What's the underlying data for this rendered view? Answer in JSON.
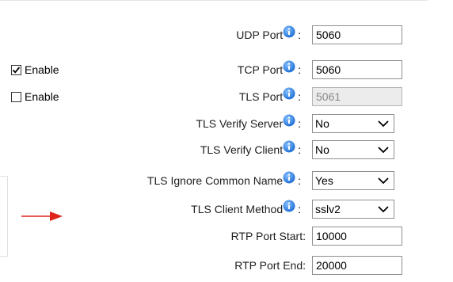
{
  "form": {
    "udp_port": {
      "label": "UDP Port",
      "value": "5060"
    },
    "tcp_port": {
      "label": "TCP Port",
      "value": "5060",
      "enable_label": "Enable",
      "enabled": true
    },
    "tls_port": {
      "label": "TLS Port",
      "value": "5061",
      "enable_label": "Enable",
      "enabled": false
    },
    "tls_verify_server": {
      "label": "TLS Verify Server",
      "value": "No"
    },
    "tls_verify_client": {
      "label": "TLS Verify Client",
      "value": "No"
    },
    "tls_ignore_common_name": {
      "label": "TLS Ignore Common Name",
      "value": "Yes"
    },
    "tls_client_method": {
      "label": "TLS Client Method",
      "value": "sslv2"
    },
    "rtp_port_start": {
      "label": "RTP Port Start",
      "value": "10000"
    },
    "rtp_port_end": {
      "label": "RTP Port End",
      "value": "20000"
    },
    "colon": ":"
  },
  "icons": {
    "info": "info-icon",
    "select_arrow": "chevron-down-icon",
    "annotation": "arrow-right-icon"
  },
  "colors": {
    "info_icon": "#2d7fe0",
    "annotation_arrow": "#e0241b"
  }
}
